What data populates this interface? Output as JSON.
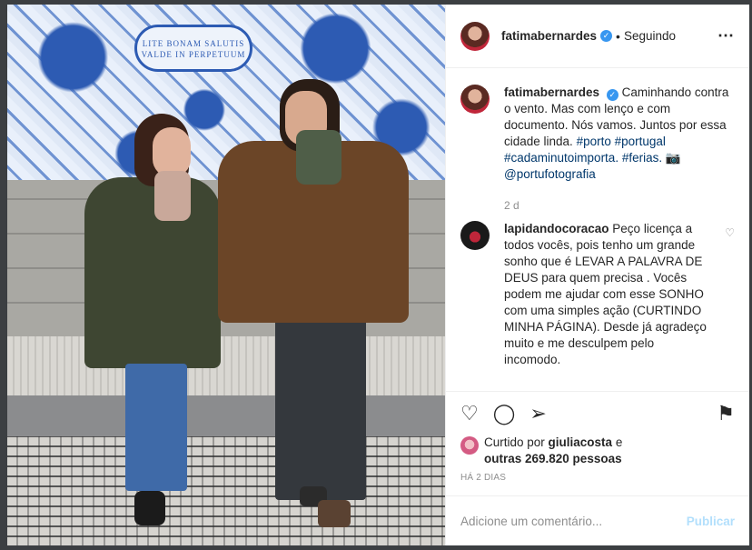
{
  "post": {
    "username": "fatimabernardes",
    "follow_status": "Seguindo",
    "plaque_text": "LITE BONAM SALUTIS VALDE IN PERPETUUM",
    "caption_user": "fatimabernardes",
    "caption_text": "Caminhando contra o vento. Mas com lenço e com documento. Nós vamos. Juntos por essa cidade linda.",
    "caption_tags": "#porto #portugal #cadaminutoimporta. #ferias.",
    "caption_camera": "📷",
    "caption_mention": "@portufotografia",
    "caption_time": "2 d"
  },
  "comment": {
    "username": "lapidandocoracao",
    "text": "Peço licença a todos vocês, pois tenho um grande sonho que é LEVAR A PALAVRA DE DEUS para quem precisa . Vocês podem me ajudar com esse SONHO com uma simples ação (CURTINDO MINHA PÁGINA). Desde já agradeço muito e me desculpem pelo incomodo."
  },
  "likes": {
    "prefix": "Curtido por ",
    "user": "giuliacosta",
    "mid": " e",
    "others": "outras 269.820 pessoas"
  },
  "time_ago": "HÁ 2 DIAS",
  "add_comment": {
    "placeholder": "Adicione um comentário...",
    "publish_label": "Publicar"
  },
  "icons": {
    "more": "⋯",
    "heart": "♡",
    "comment": "◯",
    "share": "➢",
    "save": "⚑",
    "verified": "✓"
  }
}
